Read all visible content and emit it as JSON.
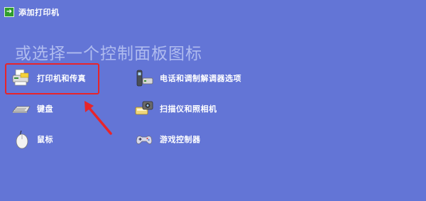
{
  "task": {
    "add_printer_label": "添加打印机",
    "icon": "add-printer-icon"
  },
  "heading": "或选择一个控制面板图标",
  "items": [
    {
      "label": "打印机和传真",
      "icon": "printer-fax-icon"
    },
    {
      "label": "键盘",
      "icon": "keyboard-icon"
    },
    {
      "label": "鼠标",
      "icon": "mouse-icon"
    },
    {
      "label": "电话和调制解调器选项",
      "icon": "phone-modem-icon"
    },
    {
      "label": "扫描仪和照相机",
      "icon": "scanner-camera-icon"
    },
    {
      "label": "游戏控制器",
      "icon": "game-controller-icon"
    }
  ],
  "colors": {
    "background": "#6375d6",
    "heading": "#b0bcef",
    "annotation": "#e8242a"
  }
}
